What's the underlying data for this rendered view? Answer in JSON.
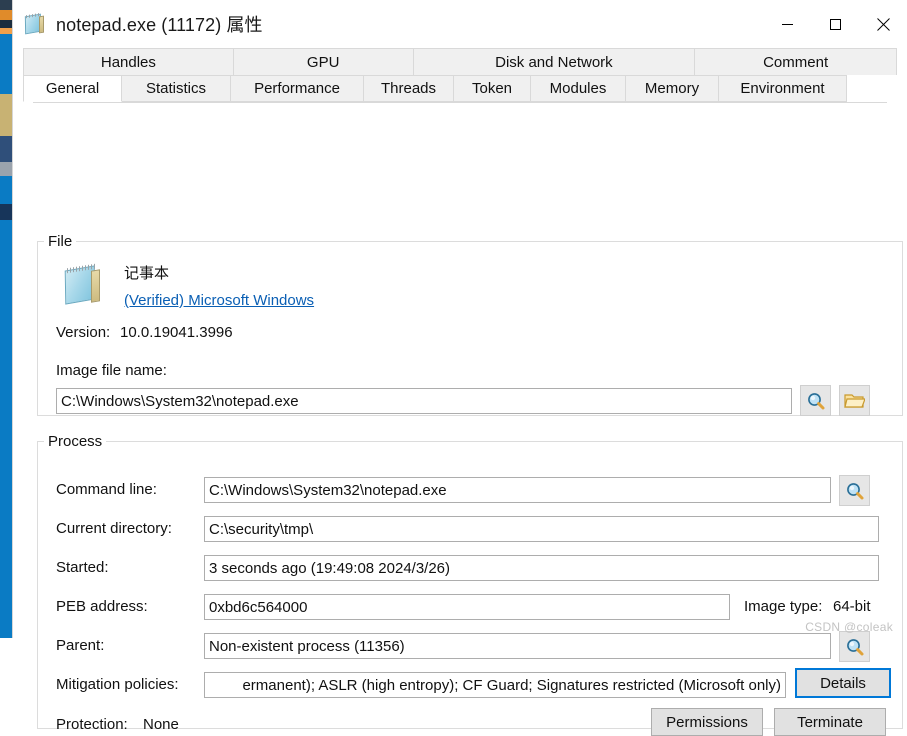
{
  "window": {
    "title": "notepad.exe (11172) 属性",
    "icon": "notepad-icon",
    "minimize_label": "—",
    "maximize_label": "□",
    "close_label": "✕"
  },
  "tabs": {
    "top_row": [
      {
        "label": "Handles",
        "selected": false
      },
      {
        "label": "GPU",
        "selected": false
      },
      {
        "label": "Disk and Network",
        "selected": false
      },
      {
        "label": "Comment",
        "selected": false
      }
    ],
    "bottom_row": [
      {
        "label": "General",
        "selected": true
      },
      {
        "label": "Statistics",
        "selected": false
      },
      {
        "label": "Performance",
        "selected": false
      },
      {
        "label": "Threads",
        "selected": false
      },
      {
        "label": "Token",
        "selected": false
      },
      {
        "label": "Modules",
        "selected": false
      },
      {
        "label": "Memory",
        "selected": false
      },
      {
        "label": "Environment",
        "selected": false
      }
    ]
  },
  "file_group": {
    "legend": "File",
    "description": "记事本",
    "signer_link": "(Verified) Microsoft Windows",
    "version_label": "Version:",
    "version_value": "10.0.19041.3996",
    "image_file_name_label": "Image file name:",
    "image_file_name_value": "C:\\Windows\\System32\\notepad.exe",
    "search_button": "search-icon",
    "open_folder_button": "folder-icon"
  },
  "process_group": {
    "legend": "Process",
    "command_line_label": "Command line:",
    "command_line_value": "C:\\Windows\\System32\\notepad.exe",
    "current_directory_label": "Current directory:",
    "current_directory_value": "C:\\security\\tmp\\",
    "started_label": "Started:",
    "started_value": "3 seconds ago (19:49:08 2024/3/26)",
    "peb_address_label": "PEB address:",
    "peb_address_value": "0xbd6c564000",
    "image_type_label": "Image type:",
    "image_type_value": "64-bit",
    "parent_label": "Parent:",
    "parent_value": "Non-existent process (11356)",
    "mitigation_label": "Mitigation policies:",
    "mitigation_value": "ermanent); ASLR (high entropy); CF Guard; Signatures restricted (Microsoft only)",
    "details_button": "Details",
    "protection_label": "Protection:",
    "protection_value": "None",
    "permissions_button": "Permissions",
    "terminate_button": "Terminate"
  },
  "watermark": "CSDN @coleak",
  "colors": {
    "accent": "#0078d7",
    "link": "#0a5fb4",
    "button_face": "#e1e1e1",
    "tab_inactive": "#f0f0f0",
    "background_window": "#0a7bc4"
  }
}
